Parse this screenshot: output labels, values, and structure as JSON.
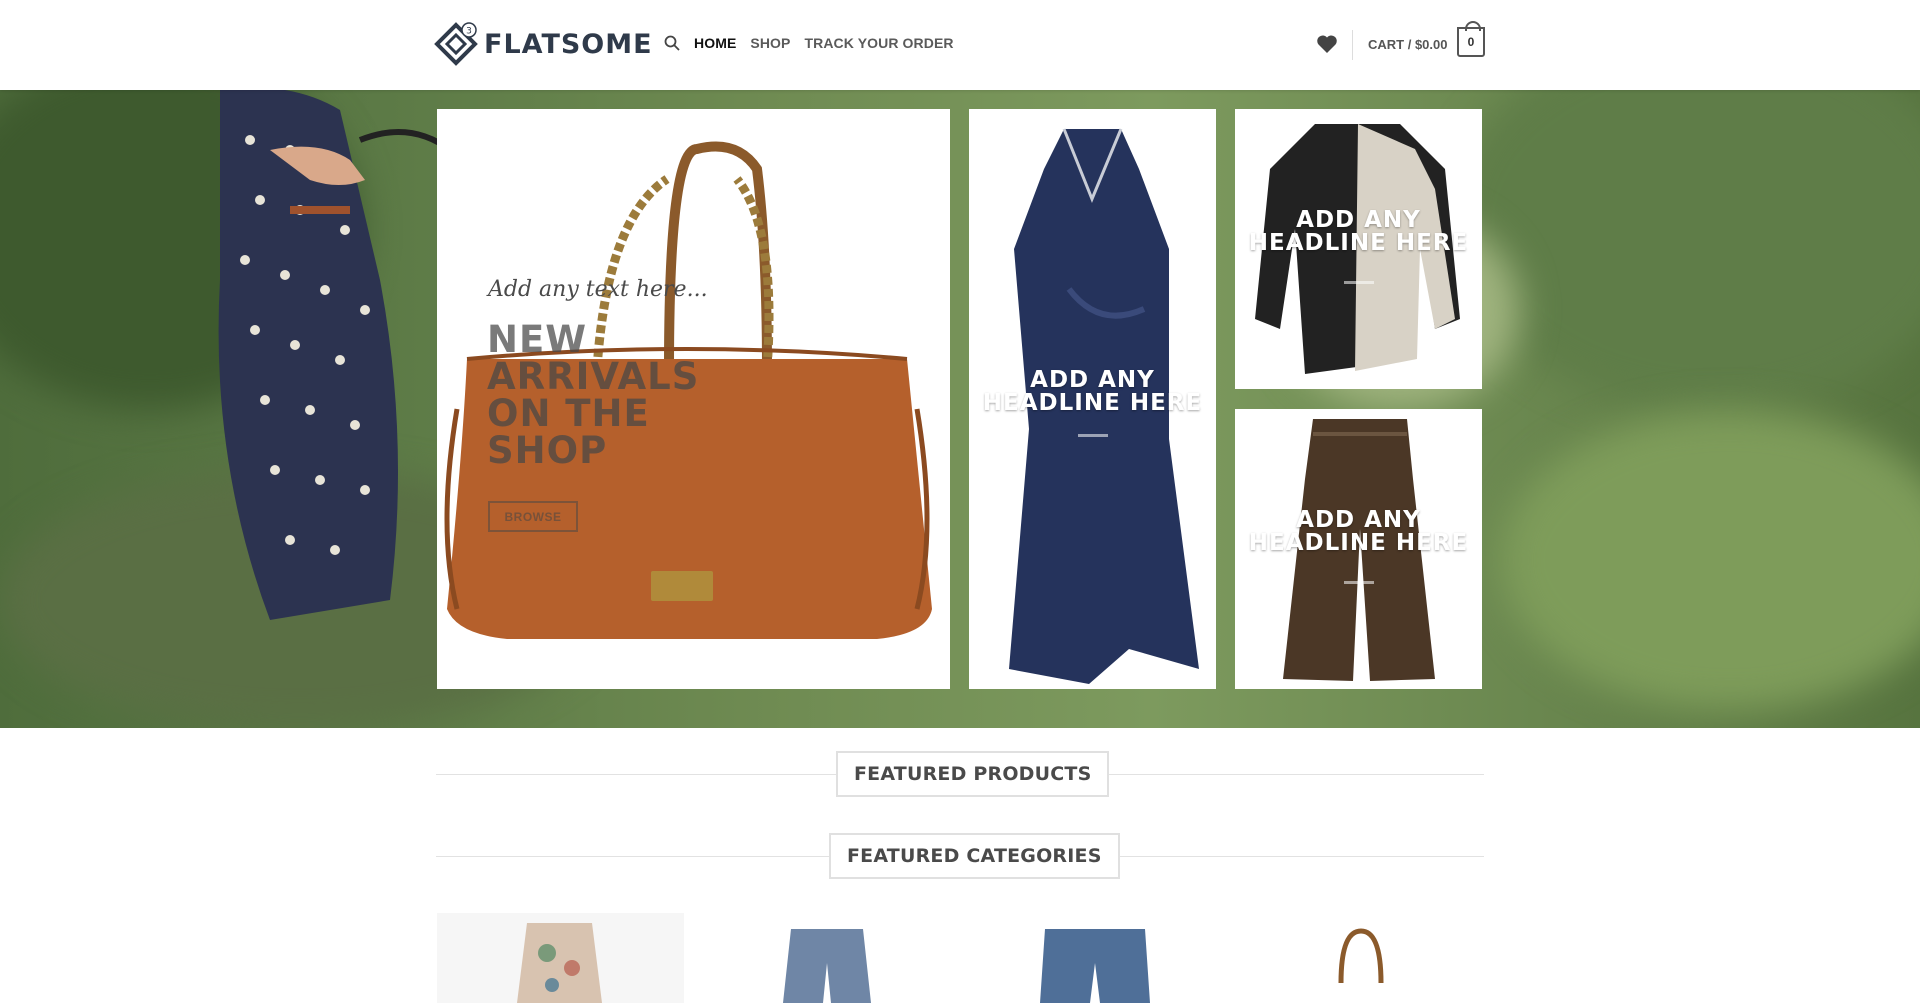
{
  "header": {
    "logo_text": "FLATSOME",
    "logo_badge": "3",
    "nav": [
      {
        "label": "HOME",
        "active": true
      },
      {
        "label": "SHOP",
        "active": false
      },
      {
        "label": "TRACK YOUR ORDER",
        "active": false
      }
    ],
    "cart_label": "CART / $0.00",
    "cart_count": "0"
  },
  "hero": {
    "main": {
      "small_text": "Add any text here...",
      "headline": "NEW ARRIVALS ON THE SHOP",
      "button": "BROWSE"
    },
    "tiles": [
      {
        "headline": "ADD ANY HEADLINE HERE"
      },
      {
        "headline": "ADD ANY HEADLINE HERE"
      },
      {
        "headline": "ADD ANY HEADLINE HERE"
      }
    ]
  },
  "sections": {
    "featured_products": "FEATURED PRODUCTS",
    "featured_categories": "FEATURED CATEGORIES"
  },
  "icons": {
    "search": "search-icon",
    "wishlist": "heart-icon",
    "cart": "cart-bag-icon"
  },
  "colors": {
    "brand": "#2f3a4a",
    "text": "#4a4a4a"
  }
}
